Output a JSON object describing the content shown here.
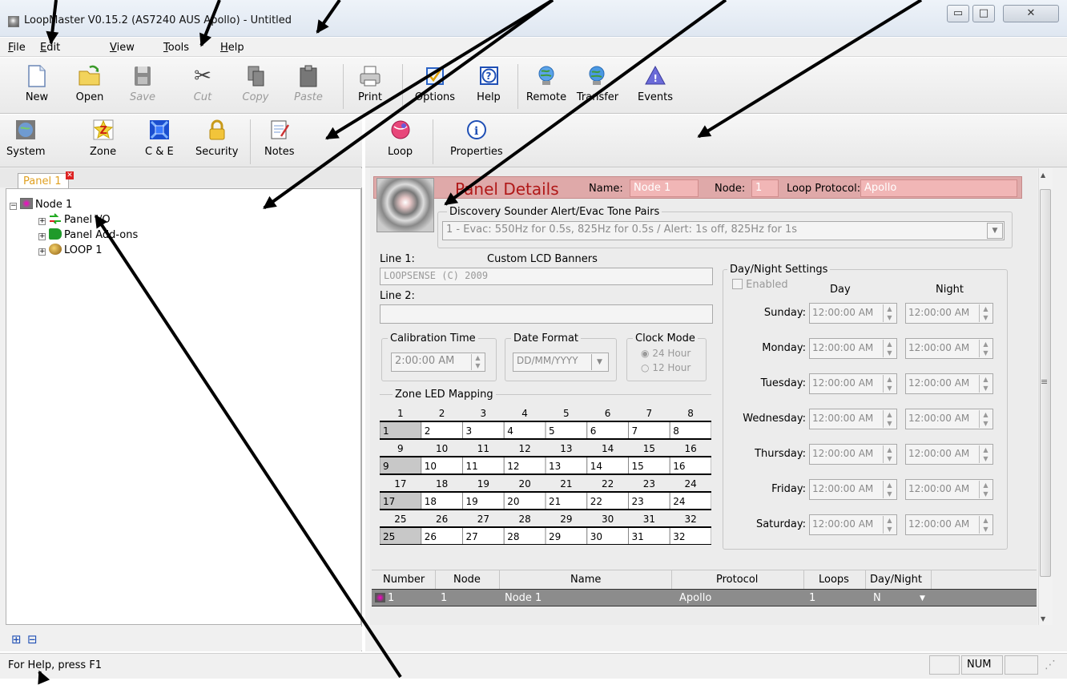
{
  "window": {
    "title": "LoopMaster V0.15.2 (AS7240 AUS Apollo) - Untitled",
    "min": "▭",
    "max": "□",
    "close": "✕"
  },
  "menu": [
    {
      "label": "File",
      "u": "F",
      "rest": "ile"
    },
    {
      "label": "Edit",
      "u": "E",
      "rest": "dit"
    },
    {
      "label": "View",
      "u": "V",
      "rest": "iew"
    },
    {
      "label": "Tools",
      "u": "T",
      "rest": "ools"
    },
    {
      "label": "Help",
      "u": "H",
      "rest": "elp"
    }
  ],
  "toolbar": {
    "new": "New",
    "open": "Open",
    "save": "Save",
    "cut": "Cut",
    "copy": "Copy",
    "paste": "Paste",
    "print": "Print",
    "options": "Options",
    "help": "Help",
    "remote": "Remote",
    "transfer": "Transfer",
    "events": "Events"
  },
  "lefttoolbar": {
    "system": "System",
    "zone": "Zone",
    "ce": "C & E",
    "security": "Security",
    "notes": "Notes"
  },
  "righttoolbar": {
    "loop": "Loop",
    "properties": "Properties"
  },
  "tab": {
    "label": "Panel 1",
    "close": "✕"
  },
  "tree": {
    "node": "Node 1",
    "io": "Panel I/O",
    "addons": "Panel Add-ons",
    "loop": "LOOP 1",
    "expanded": "−",
    "collapsed": "+"
  },
  "leftbottom": {
    "expand": "⊞",
    "collapse": "⊟"
  },
  "panel": {
    "title": "Panel Details",
    "name_label": "Name:",
    "name_value": "Node 1",
    "node_label": "Node:",
    "node_value": "1",
    "protocol_label": "Loop Protocol:",
    "protocol_value": "Apollo",
    "discovery_label": "Discovery Sounder Alert/Evac Tone Pairs",
    "discovery_value": "1 - Evac: 550Hz for 0.5s, 825Hz for 0.5s / Alert: 1s off, 825Hz for 1s",
    "line1_label": "Line 1:",
    "banners_label": "Custom LCD Banners",
    "line1_value": "LOOPSENSE (C) 2009",
    "line2_label": "Line 2:",
    "line2_value": "",
    "calib_label": "Calibration Time",
    "calib_value": "2:00:00 AM",
    "datefmt_label": "Date Format",
    "datefmt_value": "DD/MM/YYYY",
    "clock_label": "Clock Mode",
    "clock_24": "24 Hour",
    "clock_12": "12 Hour",
    "zone_label": "Zone LED Mapping",
    "daynight_label": "Day/Night Settings",
    "enabled_label": "Enabled",
    "day_col": "Day",
    "night_col": "Night",
    "days": [
      {
        "day": "Sunday:",
        "d": "12:00:00 AM",
        "n": "12:00:00 AM"
      },
      {
        "day": "Monday:",
        "d": "12:00:00 AM",
        "n": "12:00:00 AM"
      },
      {
        "day": "Tuesday:",
        "d": "12:00:00 AM",
        "n": "12:00:00 AM"
      },
      {
        "day": "Wednesday:",
        "d": "12:00:00 AM",
        "n": "12:00:00 AM"
      },
      {
        "day": "Thursday:",
        "d": "12:00:00 AM",
        "n": "12:00:00 AM"
      },
      {
        "day": "Friday:",
        "d": "12:00:00 AM",
        "n": "12:00:00 AM"
      },
      {
        "day": "Saturday:",
        "d": "12:00:00 AM",
        "n": "12:00:00 AM"
      }
    ]
  },
  "zonegrid": [
    [
      "1",
      "2",
      "3",
      "4",
      "5",
      "6",
      "7",
      "8"
    ],
    [
      "1",
      "2",
      "3",
      "4",
      "5",
      "6",
      "7",
      "8"
    ],
    [
      "9",
      "10",
      "11",
      "12",
      "13",
      "14",
      "15",
      "16"
    ],
    [
      "9",
      "10",
      "11",
      "12",
      "13",
      "14",
      "15",
      "16"
    ],
    [
      "17",
      "18",
      "19",
      "20",
      "21",
      "22",
      "23",
      "24"
    ],
    [
      "17",
      "18",
      "19",
      "20",
      "21",
      "22",
      "23",
      "24"
    ],
    [
      "25",
      "26",
      "27",
      "28",
      "29",
      "30",
      "31",
      "32"
    ],
    [
      "25",
      "26",
      "27",
      "28",
      "29",
      "30",
      "31",
      "32"
    ]
  ],
  "nodetable": {
    "headers": [
      "Number",
      "Node",
      "Name",
      "Protocol",
      "Loops",
      "Day/Night"
    ],
    "row": [
      "1",
      "1",
      "Node 1",
      "Apollo",
      "1",
      "N"
    ]
  },
  "status": {
    "help": "For Help, press F1",
    "num": "NUM"
  },
  "scrollbar": {
    "up": "▲",
    "down": "▼",
    "grip": "≡",
    "spin_up": "▲",
    "spin_down": "▼",
    "dropdown": "▼"
  }
}
